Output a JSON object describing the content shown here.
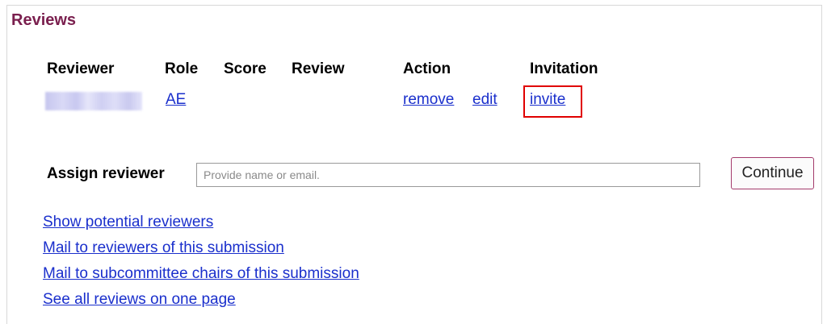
{
  "section": {
    "title": "Reviews"
  },
  "table": {
    "headers": {
      "reviewer": "Reviewer",
      "role": "Role",
      "score": "Score",
      "review": "Review",
      "action": "Action",
      "invitation": "Invitation"
    },
    "row": {
      "role": "AE",
      "score": "",
      "review": "",
      "action_remove": "remove",
      "action_edit": "edit",
      "invitation": "invite"
    }
  },
  "assign": {
    "label": "Assign reviewer",
    "placeholder": "Provide name or email.",
    "value": "",
    "button_label": "Continue"
  },
  "links": [
    "Show potential reviewers",
    "Mail to reviewers of this submission",
    "Mail to subcommittee chairs of this submission",
    "See all reviews on one page"
  ],
  "colors": {
    "title": "#7a1f4e",
    "link": "#1a2fcc",
    "highlight": "#e00000",
    "button_border": "#a33a6b"
  }
}
